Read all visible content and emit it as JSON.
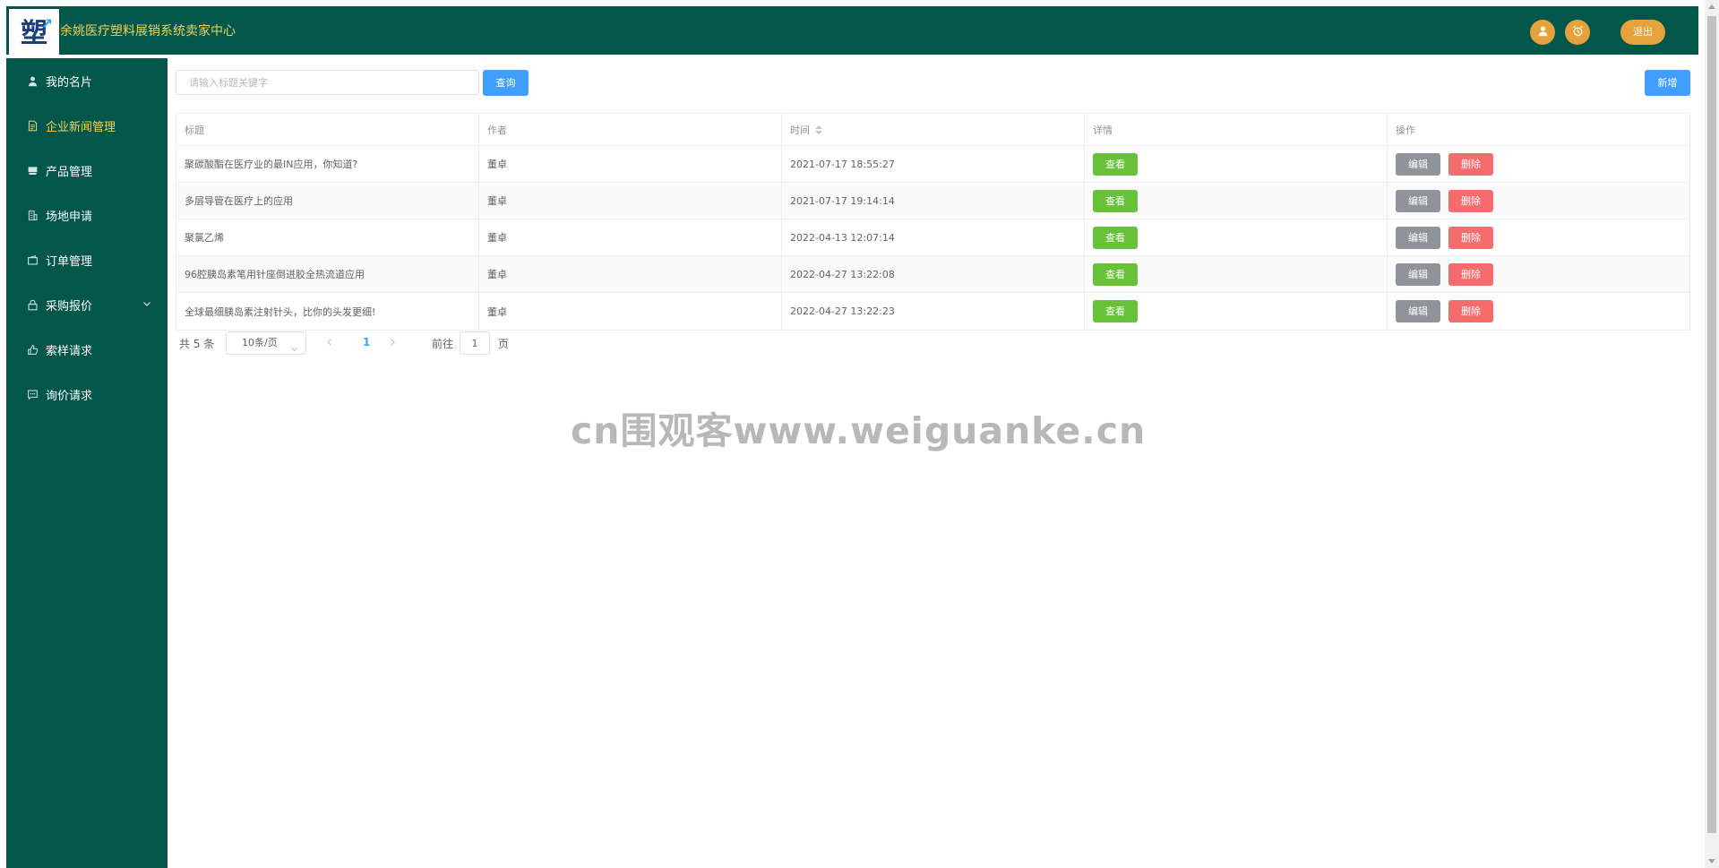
{
  "header": {
    "logo": {
      "text": "塑",
      "icon": "logo-mark"
    },
    "title": "余姚医疗塑料展销系统卖家中心",
    "icons": [
      "user-icon",
      "alarm-clock-icon"
    ],
    "logout_label": "退出",
    "colors": {
      "bar": "#02574a",
      "title": "#f0d35c",
      "accent": "#e6a23c"
    }
  },
  "sidebar": {
    "items": [
      {
        "label": "我的名片",
        "icon": "user-icon",
        "active": false
      },
      {
        "label": "企业新闻管理",
        "icon": "document-icon",
        "active": true
      },
      {
        "label": "产品管理",
        "icon": "goods-icon",
        "active": false
      },
      {
        "label": "场地申请",
        "icon": "office-building-icon",
        "active": false
      },
      {
        "label": "订单管理",
        "icon": "wallet-icon",
        "active": false
      },
      {
        "label": "采购报价",
        "icon": "lock-icon",
        "active": false,
        "expandable": true
      },
      {
        "label": "索样请求",
        "icon": "thumb-icon",
        "active": false
      },
      {
        "label": "询价请求",
        "icon": "chat-dot-icon",
        "active": false
      }
    ]
  },
  "toolbar": {
    "search_placeholder": "请输入标题关键字",
    "query_label": "查询",
    "add_label": "新增"
  },
  "table": {
    "columns": [
      "标题",
      "作者",
      "时间",
      "详情",
      "操作"
    ],
    "rows": [
      {
        "title": "聚碳酸酯在医疗业的最IN应用，你知道?",
        "author": "董卓",
        "time": "2021-07-17 18:55:27"
      },
      {
        "title": "多层导管在医疗上的应用",
        "author": "董卓",
        "time": "2021-07-17 19:14:14"
      },
      {
        "title": "聚氯乙烯",
        "author": "董卓",
        "time": "2022-04-13 12:07:14"
      },
      {
        "title": "96腔胰岛素笔用针座倒进胶全热流道应用",
        "author": "董卓",
        "time": "2022-04-27 13:22:08"
      },
      {
        "title": "全球最细胰岛素注射针头，比你的头发更细!",
        "author": "董卓",
        "time": "2022-04-27 13:22:23"
      }
    ],
    "view_label": "查看",
    "edit_label": "编辑",
    "delete_label": "删除"
  },
  "pagination": {
    "total_text": "共 5 条",
    "page_size": "10条/页",
    "current_page": "1",
    "goto_label": "前往",
    "goto_value": "1",
    "page_unit": "页"
  },
  "watermark": "cn围观客www.weiguanke.cn"
}
